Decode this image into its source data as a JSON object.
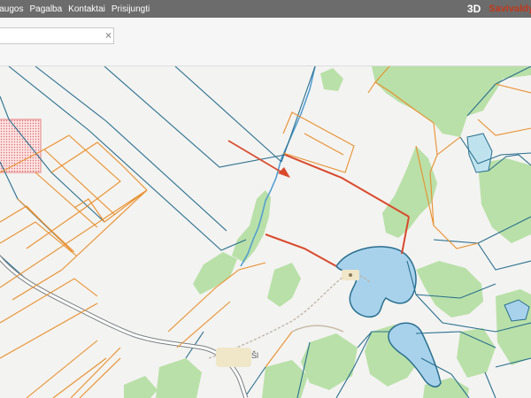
{
  "nav": {
    "items": [
      "laugos",
      "Pagalba",
      "Kontaktai",
      "Prisijungti"
    ]
  },
  "brand": {
    "label_3d": "3D",
    "name": "Savivaldy"
  },
  "search": {
    "value": "",
    "clear_icon": "×"
  },
  "map": {
    "place_label": "Šl"
  },
  "colors": {
    "topbar": "#6c6c6c",
    "brand_red": "#c0391b",
    "parcel_blue": "#2a6f8f",
    "parcel_orange": "#e98f2c",
    "forest": "#b9e0a8",
    "water": "#a8d2ec",
    "marker_red": "#d9492c"
  }
}
